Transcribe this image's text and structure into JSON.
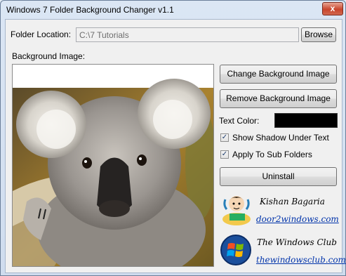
{
  "window": {
    "title": "Windows 7 Folder Background Changer v1.1",
    "close_glyph": "x"
  },
  "folder": {
    "label": "Folder Location:",
    "value": "C:\\7 Tutorials",
    "browse_label": "Browse"
  },
  "background": {
    "label": "Background Image:",
    "image_icon": "koala-photo"
  },
  "actions": {
    "change_label": "Change Background Image",
    "remove_label": "Remove Background Image",
    "uninstall_label": "Uninstall"
  },
  "text_color": {
    "label": "Text Color:",
    "value": "#000000"
  },
  "options": [
    {
      "label": "Show Shadow Under Text",
      "checked": true
    },
    {
      "label": "Apply To Sub Folders",
      "checked": true
    }
  ],
  "credits": [
    {
      "name": "Kishan Bagaria",
      "link": "door2windows.com",
      "icon": "cartoon-avatar-icon"
    },
    {
      "name": "The Windows Club",
      "link": "thewindowsclub.com",
      "icon": "windows-logo-icon"
    }
  ]
}
